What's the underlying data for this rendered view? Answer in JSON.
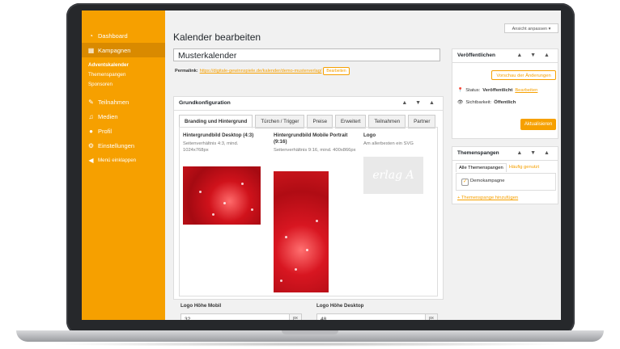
{
  "sidebar": {
    "items": [
      {
        "label": "Dashboard",
        "icon": "dashboard-icon"
      },
      {
        "label": "Kampagnen",
        "icon": "calendar-icon"
      }
    ],
    "subitems": [
      {
        "label": "Adventskalender"
      },
      {
        "label": "Themenspangen"
      },
      {
        "label": "Sponsoren"
      }
    ],
    "items2": [
      {
        "label": "Teilnahmen",
        "icon": "users-icon"
      },
      {
        "label": "Medien",
        "icon": "media-icon"
      },
      {
        "label": "Profil",
        "icon": "profile-icon"
      },
      {
        "label": "Einstellungen",
        "icon": "settings-icon"
      },
      {
        "label": "Menü einklappen",
        "icon": "collapse-icon"
      }
    ]
  },
  "main": {
    "title": "Kalender bearbeiten",
    "name_value": "Musterkalender",
    "permalink_label": "Permalink:",
    "permalink_url": "https://digitale-gewinnspiele.de/kalender/demo-musterverlag/",
    "edit_label": "Bearbeiten",
    "box_title": "Grundkonfiguration",
    "tabs": [
      "Branding und Hintergrund",
      "Türchen / Trigger",
      "Preise",
      "Erweitert",
      "Teilnahmen",
      "Partner"
    ],
    "col1_heading": "Hintergrundbild Desktop (4:3)",
    "col1_desc": "Seitenverhältnis 4:3, mind. 1024x768px",
    "col2_heading": "Hintergrundbild Mobile Portrait (9:16)",
    "col2_desc": "Seitenverhältnis 9:16, mind. 400x866px",
    "col3_heading": "Logo",
    "col3_desc": "Am allerbesten ein SVG",
    "logo_watermark": "erlag A",
    "logo_mobile_label": "Logo Höhe Mobil",
    "logo_mobile_value": "32",
    "logo_desktop_label": "Logo Höhe Desktop",
    "logo_desktop_value": "48",
    "unit": "px"
  },
  "right": {
    "screen_options": "Ansicht anpassen ▾",
    "publish_title": "Veröffentlichen",
    "preview_label": "Vorschau der Änderungen",
    "status_label": "Status:",
    "status_value": "Veröffentlicht",
    "status_edit": "Bearbeiten",
    "visibility_label": "Sichtbarkeit:",
    "visibility_value": "Öffentlich",
    "update_label": "Aktualisieren",
    "terms_title": "Themenspangen",
    "tab_all": "Alle Themenspangen",
    "tab_popular": "Häufig genutzt",
    "term_item": "Demokampagne",
    "add_term": "+ Themenspange hinzufügen"
  },
  "colors": {
    "accent": "#f6a000",
    "sidebar_active": "#d98a00",
    "image_red": "#c31018"
  },
  "box_controls": "▲ ▼ ▲"
}
